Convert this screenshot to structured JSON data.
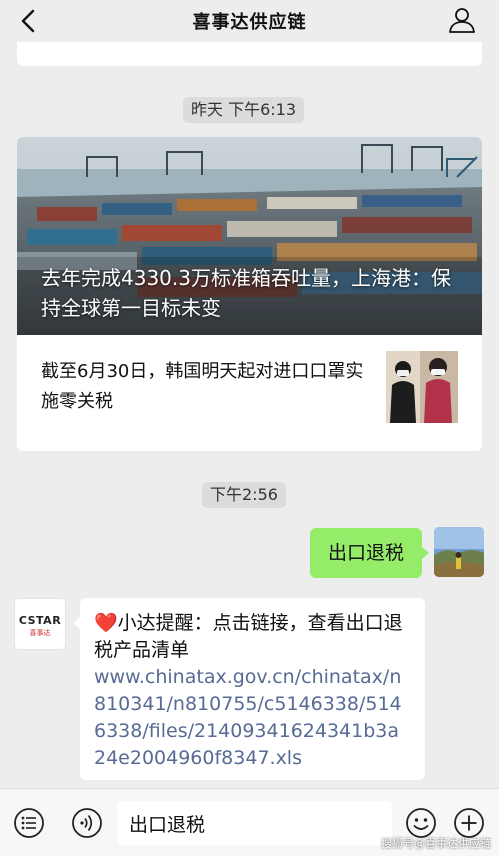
{
  "nav": {
    "title": "喜事达供应链",
    "back_icon": "chevron-left-icon",
    "profile_icon": "person-icon"
  },
  "chat": {
    "timestamp_1": "昨天 下午6:13",
    "article_card": {
      "hero_title": "去年完成4330.3万标准箱吞吐量，上海港：保持全球第一目标未变",
      "sub_title": "截至6月30日，韩国明天起对进口口罩实施零关税"
    },
    "timestamp_2": "下午2:56",
    "outgoing_message": "出口退税",
    "incoming_message": {
      "sender_logo_text": "CSTAR",
      "sender_logo_subtext": "喜事达",
      "heart_emoji": "❤️",
      "text": "小达提醒：点击链接，查看出口退税产品清单",
      "link": "www.chinatax.gov.cn/chinatax/n810341/n810755/c5146338/5146338/files/21409341624341b3a24e2004960f8347.xls"
    }
  },
  "input_bar": {
    "menu_icon": "menu-list-icon",
    "voice_icon": "voice-icon",
    "input_value": "出口退税",
    "emoji_icon": "emoji-icon",
    "plus_icon": "plus-icon",
    "watermark": "搜狐号@喜事达供应链"
  },
  "colors": {
    "background": "#ededed",
    "outgoing_bubble": "#95ec69",
    "link": "#576b95",
    "timestamp_chip": "#dcdcdc"
  }
}
